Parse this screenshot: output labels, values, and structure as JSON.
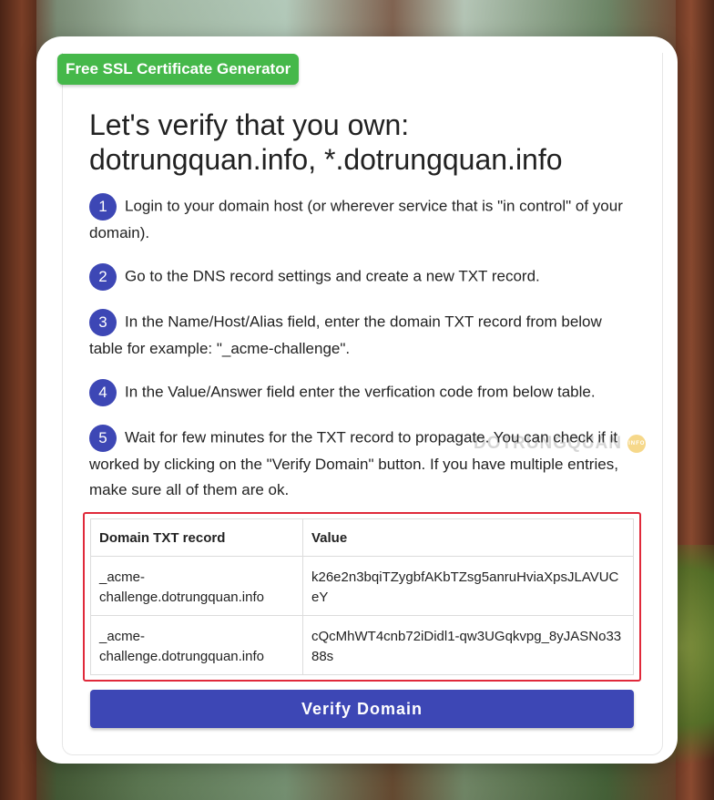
{
  "tag": "Free SSL Certificate Generator",
  "title_line1": "Let's verify that you own:",
  "title_line2": "dotrungquan.info, *.dotrungquan.info",
  "steps": [
    {
      "num": "1",
      "text": "Login to your domain host (or wherever service that is \"in control\" of your domain)."
    },
    {
      "num": "2",
      "text": "Go to the DNS record settings and create a new TXT record."
    },
    {
      "num": "3",
      "text": "In the Name/Host/Alias field, enter the domain TXT record from below table for example: \"_acme-challenge\"."
    },
    {
      "num": "4",
      "text": "In the Value/Answer field enter the verfication code from below table."
    },
    {
      "num": "5",
      "text": "Wait for few minutes for the TXT record to propagate. You can check if it worked by clicking on the \"Verify Domain\" button. If you have multiple entries, make sure all of them are ok."
    }
  ],
  "watermark": "DOTRUNGQUAN",
  "watermark_badge": "INFO",
  "table": {
    "headers": [
      "Domain TXT record",
      "Value"
    ],
    "rows": [
      [
        "_acme-challenge.dotrungquan.info",
        "k26e2n3bqiTZygbfAKbTZsg5anruHviaXpsJLAVUCeY"
      ],
      [
        "_acme-challenge.dotrungquan.info",
        "cQcMhWT4cnb72iDidl1-qw3UGqkvpg_8yJASNo3388s"
      ]
    ]
  },
  "verify_button": "Verify Domain",
  "colors": {
    "accent": "#3d47b5",
    "tag": "#45b84a",
    "highlight": "#e0293a"
  }
}
